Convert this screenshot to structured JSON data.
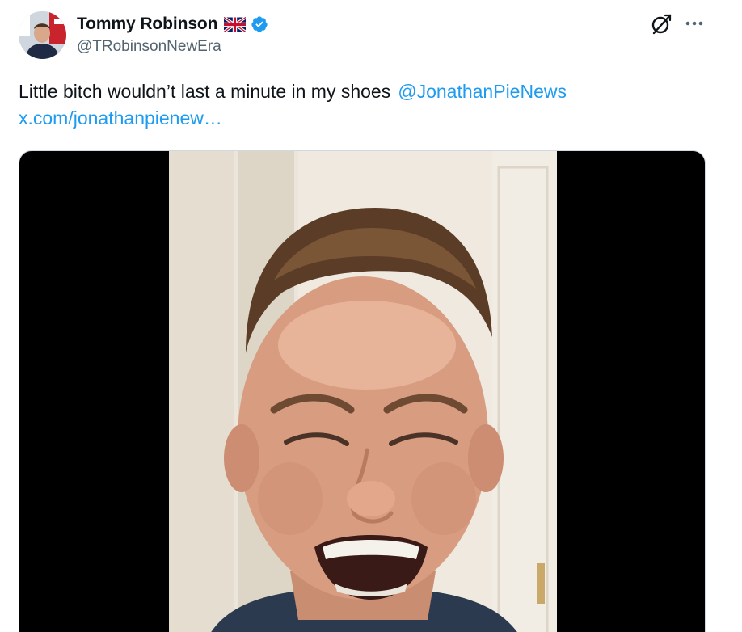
{
  "post": {
    "author": {
      "display_name": "Tommy Robinson",
      "flag_emoji": "🇬🇧",
      "handle": "@TRobinsonNewEra",
      "verified_badge_color": "#1d9bf0",
      "avatar_icon": "profile-photo"
    },
    "actions": {
      "grok_icon": "grok-icon",
      "more_icon": "more-options-icon"
    },
    "text": {
      "body": "Little bitch wouldn’t last a minute in my shoes",
      "mention": "@JonathanPieNews",
      "link": "x.com/jonathanpienew…"
    },
    "media": {
      "type": "video",
      "description_icon": "video-thumbnail"
    }
  },
  "colors": {
    "text_primary": "#0f1419",
    "text_secondary": "#536471",
    "accent": "#1d9bf0"
  }
}
